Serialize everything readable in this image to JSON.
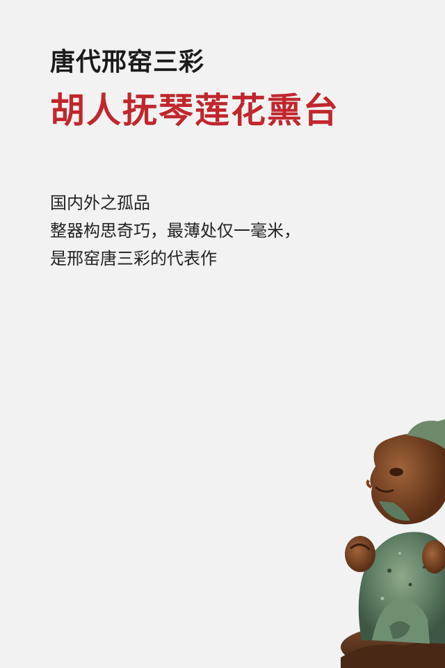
{
  "heading": {
    "title": "唐代邢窑三彩",
    "subtitle": "胡人抚琴莲花熏台"
  },
  "description": {
    "lines": [
      "国内外之孤品",
      "整器构思奇巧，最薄处仅一毫米，",
      "是邢窑唐三彩的代表作"
    ]
  },
  "colors": {
    "background": "#f2f2f2",
    "title": "#1a1a1a",
    "subtitle": "#c0272d",
    "body_text": "#222222"
  }
}
